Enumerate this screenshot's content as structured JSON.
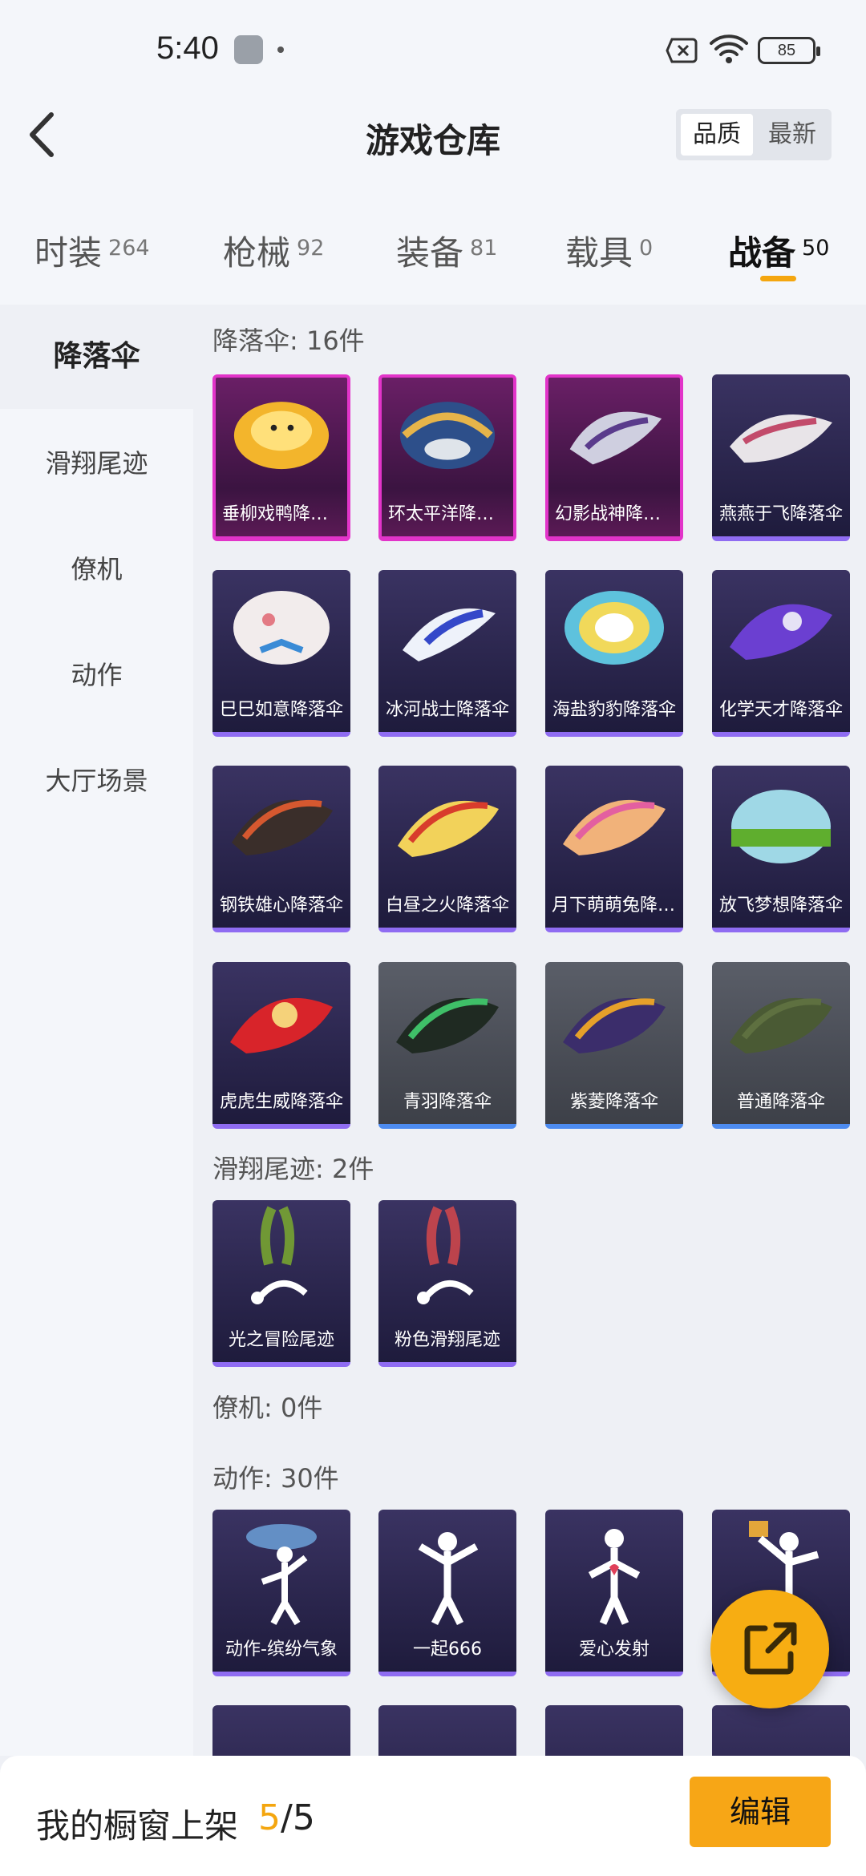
{
  "status": {
    "time": "5:40",
    "battery": "85"
  },
  "header": {
    "title": "游戏仓库",
    "sort": [
      "品质",
      "最新"
    ]
  },
  "tabs": [
    {
      "label": "时装",
      "count": "264"
    },
    {
      "label": "枪械",
      "count": "92"
    },
    {
      "label": "装备",
      "count": "81"
    },
    {
      "label": "载具",
      "count": "0"
    },
    {
      "label": "战备",
      "count": "50"
    }
  ],
  "sidebar": [
    "降落伞",
    "滑翔尾迹",
    "僚机",
    "动作",
    "大厅场景"
  ],
  "sections": {
    "parachute": "降落伞: 16件",
    "trail": "滑翔尾迹: 2件",
    "wingman": "僚机: 0件",
    "emote": "动作: 30件"
  },
  "parachutes": [
    "垂柳戏鸭降落伞",
    "环太平洋降落伞",
    "幻影战神降落伞",
    "燕燕于飞降落伞",
    "巳巳如意降落伞",
    "冰河战士降落伞",
    "海盐豹豹降落伞",
    "化学天才降落伞",
    "钢铁雄心降落伞",
    "白昼之火降落伞",
    "月下萌萌兔降落伞",
    "放飞梦想降落伞",
    "虎虎生威降落伞",
    "青羽降落伞",
    "紫菱降落伞",
    "普通降落伞"
  ],
  "trails": [
    "光之冒险尾迹",
    "粉色滑翔尾迹"
  ],
  "emotes": [
    "动作-缤纷气象",
    "一起666",
    "爱心发射"
  ],
  "bottom": {
    "label": "我的橱窗上架",
    "current": "5",
    "total": "/5",
    "edit": "编辑"
  },
  "colors": {
    "accent": "#f4a60f",
    "legendary": "#e234c9",
    "epic": "#8f6cf2",
    "rare": "#4d8bf0"
  }
}
